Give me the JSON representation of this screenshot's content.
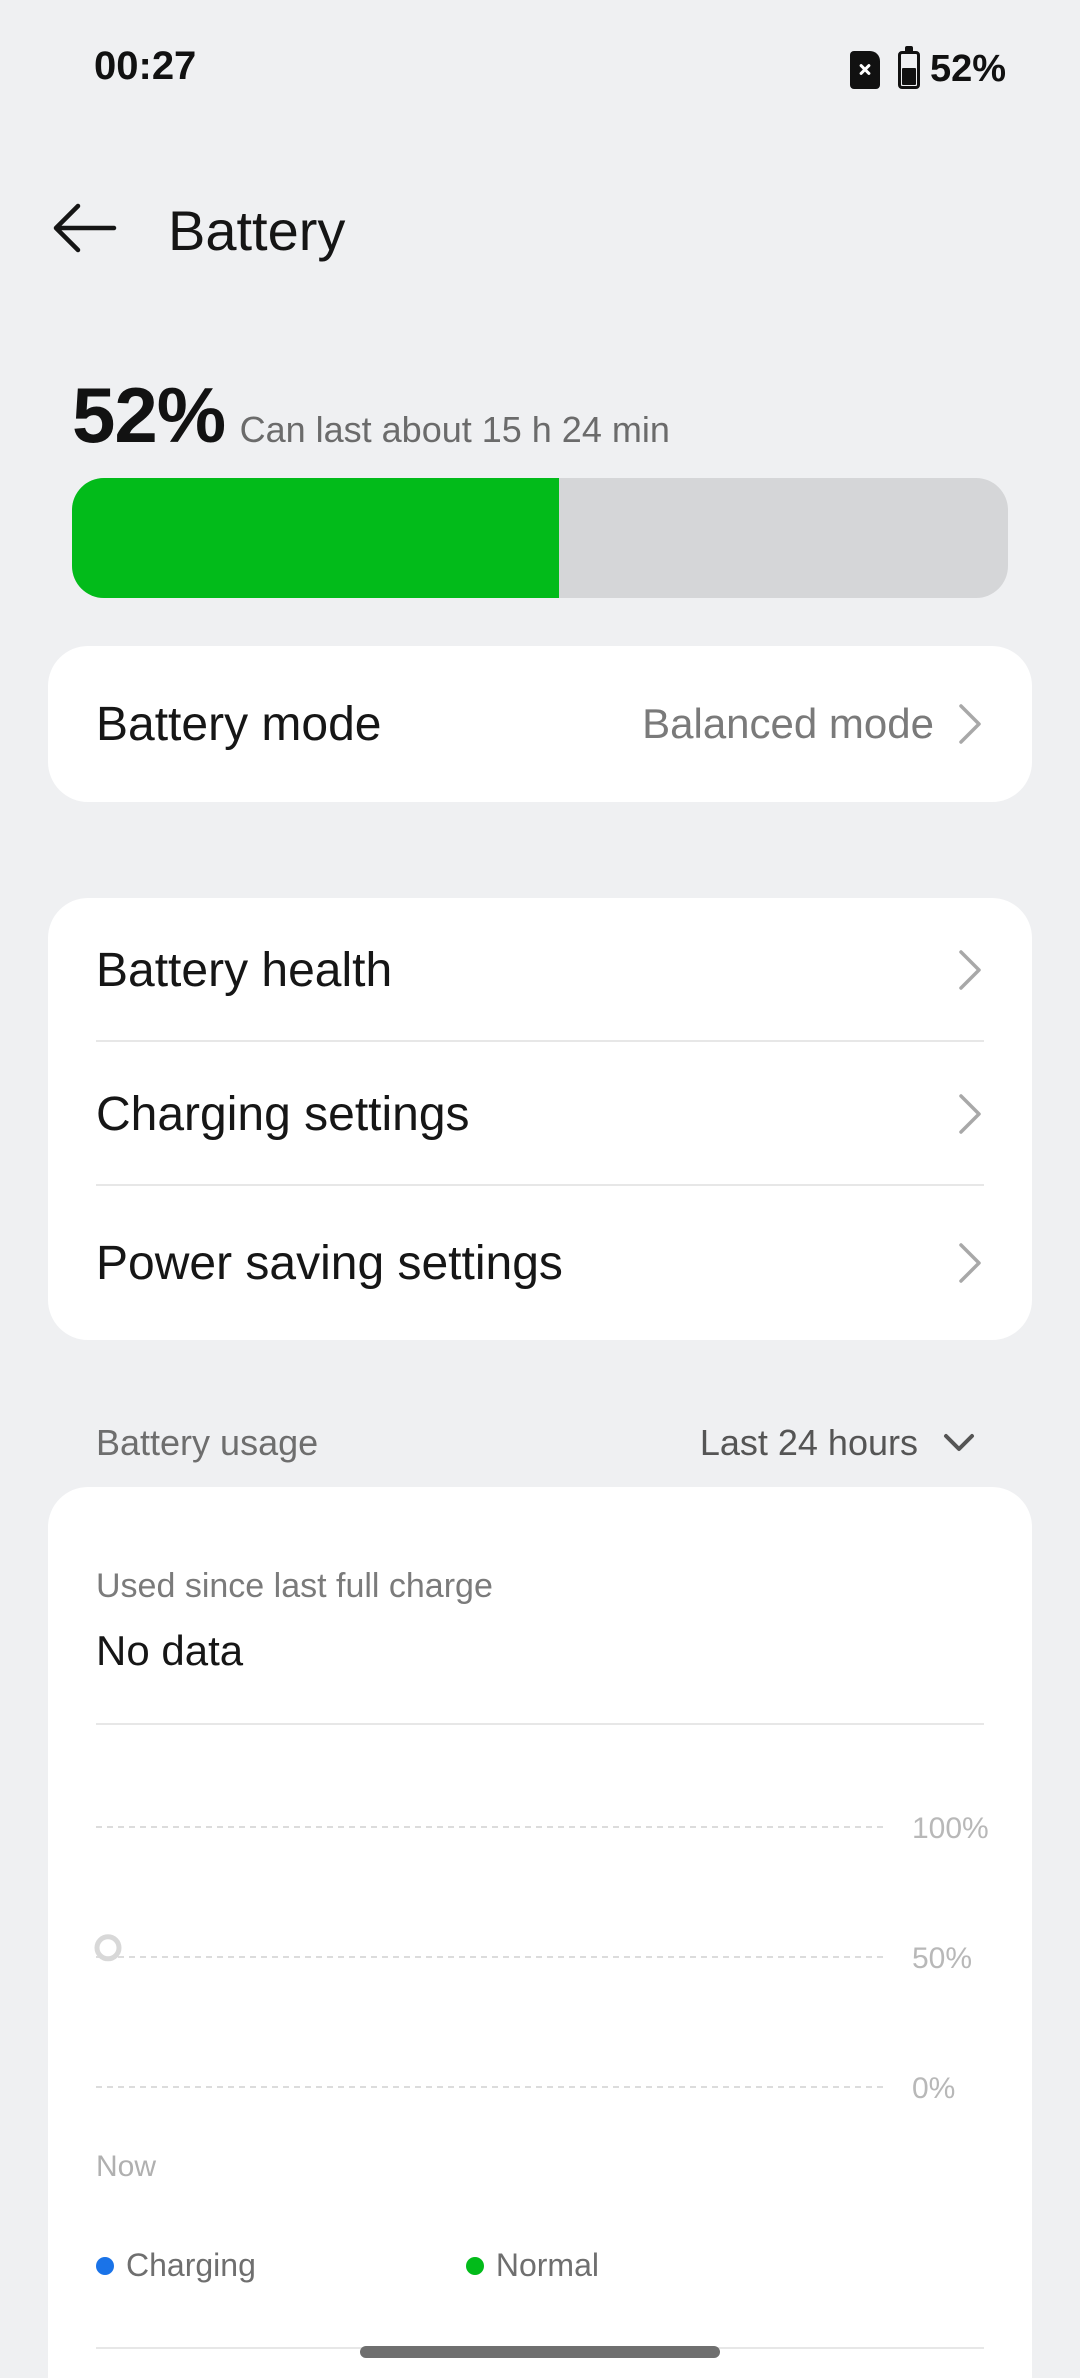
{
  "status_bar": {
    "time": "00:27",
    "battery_percent": "52%"
  },
  "header": {
    "title": "Battery"
  },
  "battery": {
    "level_text": "52%",
    "level_fraction": 0.52,
    "estimate": "Can last about 15 h 24 min",
    "fill_color": "#02bb1a"
  },
  "mode_card": {
    "label": "Battery mode",
    "value": "Balanced mode"
  },
  "settings": [
    {
      "label": "Battery health"
    },
    {
      "label": "Charging settings"
    },
    {
      "label": "Power saving settings"
    }
  ],
  "usage": {
    "title": "Battery usage",
    "range": "Last 24 hours",
    "used_since_label": "Used since last full charge",
    "used_since_value": "No data"
  },
  "chart_data": {
    "type": "line",
    "y_tick_labels": [
      "100%",
      "50%",
      "0%"
    ],
    "ylim": [
      0,
      100
    ],
    "x_tick_labels": [
      "Now"
    ],
    "series": [
      {
        "name": "Charging",
        "color": "#1a73e8",
        "values": []
      },
      {
        "name": "Normal",
        "color": "#02bb1a",
        "values": []
      }
    ],
    "current_point": {
      "x": "Now",
      "y": 52
    }
  }
}
